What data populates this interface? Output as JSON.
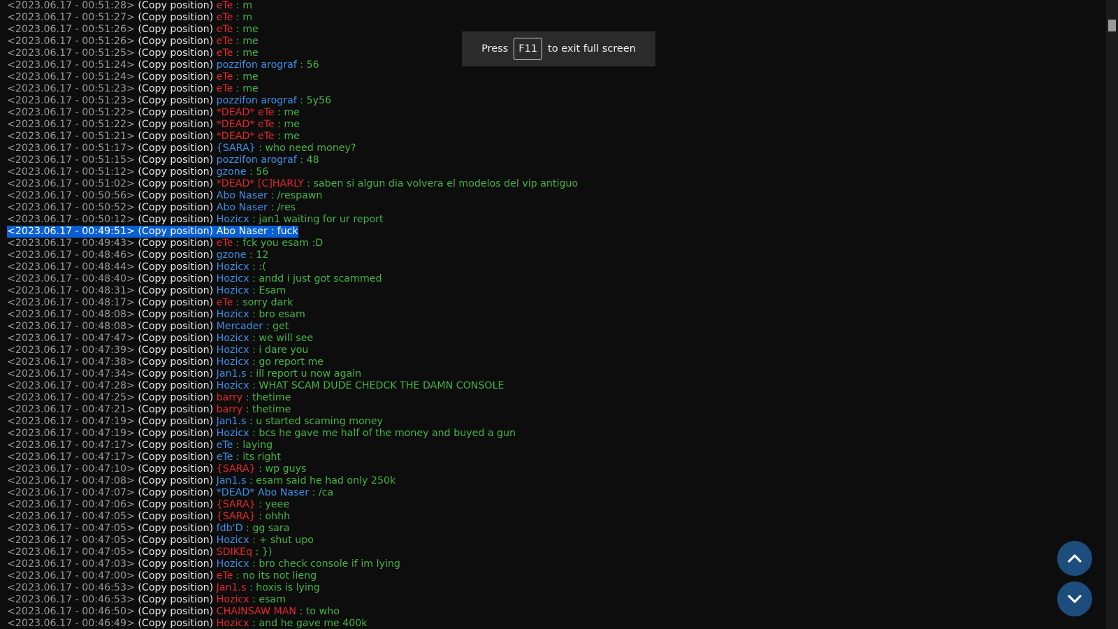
{
  "toast": {
    "press": "Press",
    "key": "F11",
    "rest": "to exit full screen"
  },
  "colors": {
    "background": "#0d0d0d",
    "message": "#47b347",
    "name_red": "#e3272a",
    "name_blue": "#3f8ee6",
    "selection": "#0a5fd4",
    "button": "#1c4d7c"
  },
  "buttons": {
    "up": "chevron-up-icon",
    "down": "chevron-down-icon"
  },
  "copy_label": "(Copy position)",
  "lines": [
    {
      "ts": "<2023.06.17 - 00:51:28>",
      "name": "eTe",
      "color": "red",
      "msg": "m"
    },
    {
      "ts": "<2023.06.17 - 00:51:27>",
      "name": "eTe",
      "color": "red",
      "msg": "m"
    },
    {
      "ts": "<2023.06.17 - 00:51:26>",
      "name": "eTe",
      "color": "red",
      "msg": "me"
    },
    {
      "ts": "<2023.06.17 - 00:51:26>",
      "name": "eTe",
      "color": "red",
      "msg": "me"
    },
    {
      "ts": "<2023.06.17 - 00:51:25>",
      "name": "eTe",
      "color": "red",
      "msg": "me"
    },
    {
      "ts": "<2023.06.17 - 00:51:24>",
      "name": "pozzifon arograf",
      "color": "blue",
      "msg": "56"
    },
    {
      "ts": "<2023.06.17 - 00:51:24>",
      "name": "eTe",
      "color": "red",
      "msg": "me"
    },
    {
      "ts": "<2023.06.17 - 00:51:23>",
      "name": "eTe",
      "color": "red",
      "msg": "me"
    },
    {
      "ts": "<2023.06.17 - 00:51:23>",
      "name": "pozzifon arograf",
      "color": "blue",
      "msg": "5y56"
    },
    {
      "ts": "<2023.06.17 - 00:51:22>",
      "name": "*DEAD* eTe",
      "color": "red",
      "msg": "me"
    },
    {
      "ts": "<2023.06.17 - 00:51:22>",
      "name": "*DEAD* eTe",
      "color": "red",
      "msg": "me"
    },
    {
      "ts": "<2023.06.17 - 00:51:21>",
      "name": "*DEAD* eTe",
      "color": "red",
      "msg": "me"
    },
    {
      "ts": "<2023.06.17 - 00:51:17>",
      "name": "{SARA}",
      "color": "blue",
      "msg": "who need money?"
    },
    {
      "ts": "<2023.06.17 - 00:51:15>",
      "name": "pozzifon arograf",
      "color": "blue",
      "msg": "48"
    },
    {
      "ts": "<2023.06.17 - 00:51:12>",
      "name": "gzone",
      "color": "blue",
      "msg": "56"
    },
    {
      "ts": "<2023.06.17 - 00:51:02>",
      "name": "*DEAD* [C]HARLY",
      "color": "red",
      "msg": "saben si algun dia volvera el modelos del vip antiguo"
    },
    {
      "ts": "<2023.06.17 - 00:50:56>",
      "name": "Abo Naser",
      "color": "blue",
      "msg": "/respawn"
    },
    {
      "ts": "<2023.06.17 - 00:50:52>",
      "name": "Abo Naser",
      "color": "blue",
      "msg": "/res"
    },
    {
      "ts": "<2023.06.17 - 00:50:12>",
      "name": "Hozicx",
      "color": "blue",
      "msg": "jan1 waiting for ur report"
    },
    {
      "ts": "<2023.06.17 - 00:49:51>",
      "name": "Abo Naser",
      "color": "blue",
      "msg": "fuck",
      "selected": true
    },
    {
      "ts": "<2023.06.17 - 00:49:43>",
      "name": "eTe",
      "color": "red",
      "msg": "fck you esam :D"
    },
    {
      "ts": "<2023.06.17 - 00:48:46>",
      "name": "gzone",
      "color": "blue",
      "msg": "12"
    },
    {
      "ts": "<2023.06.17 - 00:48:44>",
      "name": "Hozicx",
      "color": "blue",
      "msg": ":("
    },
    {
      "ts": "<2023.06.17 - 00:48:40>",
      "name": "Hozicx",
      "color": "blue",
      "msg": "andd i just got scammed"
    },
    {
      "ts": "<2023.06.17 - 00:48:31>",
      "name": "Hozicx",
      "color": "blue",
      "msg": "Esam"
    },
    {
      "ts": "<2023.06.17 - 00:48:17>",
      "name": "eTe",
      "color": "red",
      "msg": "sorry dark"
    },
    {
      "ts": "<2023.06.17 - 00:48:08>",
      "name": "Hozicx",
      "color": "blue",
      "msg": "bro esam"
    },
    {
      "ts": "<2023.06.17 - 00:48:08>",
      "name": "Mercader",
      "color": "blue",
      "msg": "get"
    },
    {
      "ts": "<2023.06.17 - 00:47:47>",
      "name": "Hozicx",
      "color": "blue",
      "msg": "we will see"
    },
    {
      "ts": "<2023.06.17 - 00:47:39>",
      "name": "Hozicx",
      "color": "blue",
      "msg": "i dare you"
    },
    {
      "ts": "<2023.06.17 - 00:47:38>",
      "name": "Hozicx",
      "color": "blue",
      "msg": "go report me"
    },
    {
      "ts": "<2023.06.17 - 00:47:34>",
      "name": "Jan1.s",
      "color": "blue",
      "msg": "ill report u now again"
    },
    {
      "ts": "<2023.06.17 - 00:47:28>",
      "name": "Hozicx",
      "color": "blue",
      "msg": "WHAT SCAM DUDE CHEDCK THE DAMN CONSOLE"
    },
    {
      "ts": "<2023.06.17 - 00:47:25>",
      "name": "barry",
      "color": "red",
      "msg": "thetime"
    },
    {
      "ts": "<2023.06.17 - 00:47:21>",
      "name": "barry",
      "color": "red",
      "msg": "thetime"
    },
    {
      "ts": "<2023.06.17 - 00:47:19>",
      "name": "Jan1.s",
      "color": "blue",
      "msg": "u started scaming money"
    },
    {
      "ts": "<2023.06.17 - 00:47:19>",
      "name": "Hozicx",
      "color": "blue",
      "msg": "bcs he gave me half of the money and buyed a gun"
    },
    {
      "ts": "<2023.06.17 - 00:47:17>",
      "name": "eTe",
      "color": "blue",
      "msg": "laying"
    },
    {
      "ts": "<2023.06.17 - 00:47:17>",
      "name": "eTe",
      "color": "blue",
      "msg": "its right"
    },
    {
      "ts": "<2023.06.17 - 00:47:10>",
      "name": "{SARA}",
      "color": "red",
      "msg": "wp guys"
    },
    {
      "ts": "<2023.06.17 - 00:47:08>",
      "name": "Jan1.s",
      "color": "blue",
      "msg": "esam said he had only 250k"
    },
    {
      "ts": "<2023.06.17 - 00:47:07>",
      "name": "*DEAD* Abo Naser",
      "color": "blue",
      "msg": "/ca"
    },
    {
      "ts": "<2023.06.17 - 00:47:06>",
      "name": "{SARA}",
      "color": "red",
      "msg": "yeee"
    },
    {
      "ts": "<2023.06.17 - 00:47:05>",
      "name": "{SARA}",
      "color": "red",
      "msg": "ohhh"
    },
    {
      "ts": "<2023.06.17 - 00:47:05>",
      "name": "fdb'D",
      "color": "blue",
      "msg": "gg sara"
    },
    {
      "ts": "<2023.06.17 - 00:47:05>",
      "name": "Hozicx",
      "color": "blue",
      "msg": "+ shut upo"
    },
    {
      "ts": "<2023.06.17 - 00:47:05>",
      "name": "SDIKEq",
      "color": "red",
      "msg": "})"
    },
    {
      "ts": "<2023.06.17 - 00:47:03>",
      "name": "Hozicx",
      "color": "blue",
      "msg": "bro check console if im lying"
    },
    {
      "ts": "<2023.06.17 - 00:47:00>",
      "name": "eTe",
      "color": "red",
      "msg": "no its not lieng"
    },
    {
      "ts": "<2023.06.17 - 00:46:53>",
      "name": "Jan1.s",
      "color": "red",
      "msg": "hoxis is lying"
    },
    {
      "ts": "<2023.06.17 - 00:46:53>",
      "name": "Hozicx",
      "color": "red",
      "msg": "esam"
    },
    {
      "ts": "<2023.06.17 - 00:46:50>",
      "name": "CHAINSAW MAN",
      "color": "red",
      "msg": "to who"
    },
    {
      "ts": "<2023.06.17 - 00:46:49>",
      "name": "Hozicx",
      "color": "red",
      "msg": "and he gave me 400k"
    }
  ]
}
